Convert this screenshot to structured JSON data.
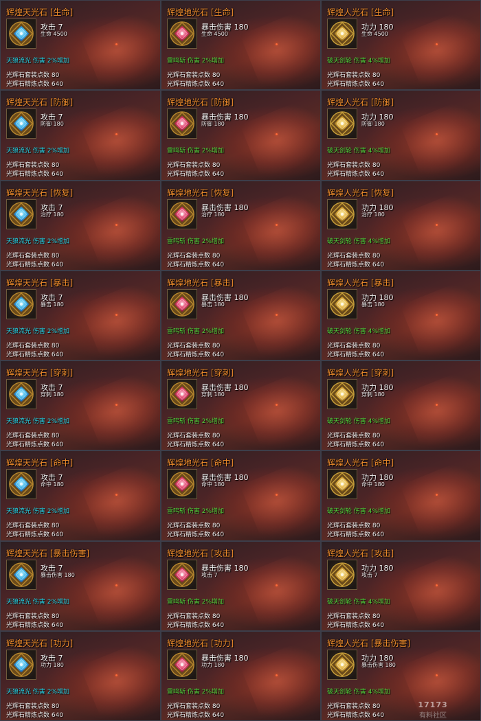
{
  "colors": {
    "title": "#ee8c2c",
    "sky_effect": "#22d3e6",
    "earth_effect": "#4fd33a",
    "stat_text": "#f0f0f0",
    "border": "#3c3e4a"
  },
  "icons": {
    "sky": "blue-gem-icon",
    "earth": "red-gem-icon",
    "human": "gold-gem-icon"
  },
  "watermark": {
    "logo": "17173",
    "text": "有料社区"
  },
  "cards": [
    {
      "type": "sky",
      "title": "辉煌天光石 [生命]",
      "stat1": "攻击 7",
      "stat2": "生命 4500",
      "effect": "天狼流光 伤害 2%增加",
      "line1": "光辉石套装点数 80",
      "line2": "光辉石精炼点数 640"
    },
    {
      "type": "earth",
      "title": "辉煌地光石 [生命]",
      "stat1": "暴击伤害 180",
      "stat2": "生命 4500",
      "effect": "雷鸣斩 伤害 2%增加",
      "line1": "光辉石套装点数 80",
      "line2": "光辉石精炼点数 640"
    },
    {
      "type": "human",
      "title": "辉煌人光石 [生命]",
      "stat1": "功力 180",
      "stat2": "生命 4500",
      "effect": "破天剑轮 伤害 4%增加",
      "line1": "光辉石套装点数 80",
      "line2": "光辉石精炼点数 640"
    },
    {
      "type": "sky",
      "title": "辉煌天光石 [防御]",
      "stat1": "攻击 7",
      "stat2": "防御 180",
      "effect": "天狼流光 伤害 2%增加",
      "line1": "光辉石套装点数 80",
      "line2": "光辉石精炼点数 640"
    },
    {
      "type": "earth",
      "title": "辉煌地光石 [防御]",
      "stat1": "暴击伤害 180",
      "stat2": "防御 180",
      "effect": "雷鸣斩 伤害 2%增加",
      "line1": "光辉石套装点数 80",
      "line2": "光辉石精炼点数 640"
    },
    {
      "type": "human",
      "title": "辉煌人光石 [防御]",
      "stat1": "功力 180",
      "stat2": "防御 180",
      "effect": "破天剑轮 伤害 4%增加",
      "line1": "光辉石套装点数 80",
      "line2": "光辉石精炼点数 640"
    },
    {
      "type": "sky",
      "title": "辉煌天光石 [恢复]",
      "stat1": "攻击 7",
      "stat2": "治疗 180",
      "effect": "天狼流光 伤害 2%增加",
      "line1": "光辉石套装点数 80",
      "line2": "光辉石精炼点数 640"
    },
    {
      "type": "earth",
      "title": "辉煌地光石 [恢复]",
      "stat1": "暴击伤害 180",
      "stat2": "治疗 180",
      "effect": "雷鸣斩 伤害 2%增加",
      "line1": "光辉石套装点数 80",
      "line2": "光辉石精炼点数 640"
    },
    {
      "type": "human",
      "title": "辉煌人光石 [恢复]",
      "stat1": "功力 180",
      "stat2": "治疗 180",
      "effect": "破天剑轮 伤害 4%增加",
      "line1": "光辉石套装点数 80",
      "line2": "光辉石精炼点数 640"
    },
    {
      "type": "sky",
      "title": "辉煌天光石 [暴击]",
      "stat1": "攻击 7",
      "stat2": "暴击 180",
      "effect": "天狼流光 伤害 2%增加",
      "line1": "光辉石套装点数 80",
      "line2": "光辉石精炼点数 640"
    },
    {
      "type": "earth",
      "title": "辉煌地光石 [暴击]",
      "stat1": "暴击伤害 180",
      "stat2": "暴击 180",
      "effect": "雷鸣斩 伤害 2%增加",
      "line1": "光辉石套装点数 80",
      "line2": "光辉石精炼点数 640"
    },
    {
      "type": "human",
      "title": "辉煌人光石 [暴击]",
      "stat1": "功力 180",
      "stat2": "暴击 180",
      "effect": "破天剑轮 伤害 4%增加",
      "line1": "光辉石套装点数 80",
      "line2": "光辉石精炼点数 640"
    },
    {
      "type": "sky",
      "title": "辉煌天光石 [穿刺]",
      "stat1": "攻击 7",
      "stat2": "穿刺 180",
      "effect": "天狼流光 伤害 2%增加",
      "line1": "光辉石套装点数 80",
      "line2": "光辉石精炼点数 640"
    },
    {
      "type": "earth",
      "title": "辉煌地光石 [穿刺]",
      "stat1": "暴击伤害 180",
      "stat2": "穿刺 180",
      "effect": "雷鸣斩 伤害 2%增加",
      "line1": "光辉石套装点数 80",
      "line2": "光辉石精炼点数 640"
    },
    {
      "type": "human",
      "title": "辉煌人光石 [穿刺]",
      "stat1": "功力 180",
      "stat2": "穿刺 180",
      "effect": "破天剑轮 伤害 4%增加",
      "line1": "光辉石套装点数 80",
      "line2": "光辉石精炼点数 640"
    },
    {
      "type": "sky",
      "title": "辉煌天光石 [命中]",
      "stat1": "攻击 7",
      "stat2": "命中 180",
      "effect": "天狼流光 伤害 2%增加",
      "line1": "光辉石套装点数 80",
      "line2": "光辉石精炼点数 640"
    },
    {
      "type": "earth",
      "title": "辉煌地光石 [命中]",
      "stat1": "暴击伤害 180",
      "stat2": "命中 180",
      "effect": "雷鸣斩 伤害 2%增加",
      "line1": "光辉石套装点数 80",
      "line2": "光辉石精炼点数 640"
    },
    {
      "type": "human",
      "title": "辉煌人光石 [命中]",
      "stat1": "功力 180",
      "stat2": "命中 180",
      "effect": "破天剑轮 伤害 4%增加",
      "line1": "光辉石套装点数 80",
      "line2": "光辉石精炼点数 640"
    },
    {
      "type": "sky",
      "title": "辉煌天光石 [暴击伤害]",
      "stat1": "攻击 7",
      "stat2": "暴击伤害 180",
      "effect": "天狼流光 伤害 2%增加",
      "line1": "光辉石套装点数 80",
      "line2": "光辉石精炼点数 640"
    },
    {
      "type": "earth",
      "title": "辉煌地光石 [攻击]",
      "stat1": "暴击伤害 180",
      "stat2": "攻击 7",
      "effect": "雷鸣斩 伤害 2%增加",
      "line1": "光辉石套装点数 80",
      "line2": "光辉石精炼点数 640"
    },
    {
      "type": "human",
      "title": "辉煌人光石 [攻击]",
      "stat1": "功力 180",
      "stat2": "攻击 7",
      "effect": "破天剑轮 伤害 4%增加",
      "line1": "光辉石套装点数 80",
      "line2": "光辉石精炼点数 640"
    },
    {
      "type": "sky",
      "title": "辉煌天光石 [功力]",
      "stat1": "攻击 7",
      "stat2": "功力 180",
      "effect": "天狼流光 伤害 2%增加",
      "line1": "光辉石套装点数 80",
      "line2": "光辉石精炼点数 640"
    },
    {
      "type": "earth",
      "title": "辉煌地光石 [功力]",
      "stat1": "暴击伤害 180",
      "stat2": "功力 180",
      "effect": "雷鸣斩 伤害 2%增加",
      "line1": "光辉石套装点数 80",
      "line2": "光辉石精炼点数 640"
    },
    {
      "type": "human",
      "title": "辉煌人光石 [暴击伤害]",
      "stat1": "功力 180",
      "stat2": "暴击伤害 180",
      "effect": "破天剑轮 伤害 4%增加",
      "line1": "光辉石套装点数 80",
      "line2": "光辉石精炼点数 640"
    }
  ]
}
